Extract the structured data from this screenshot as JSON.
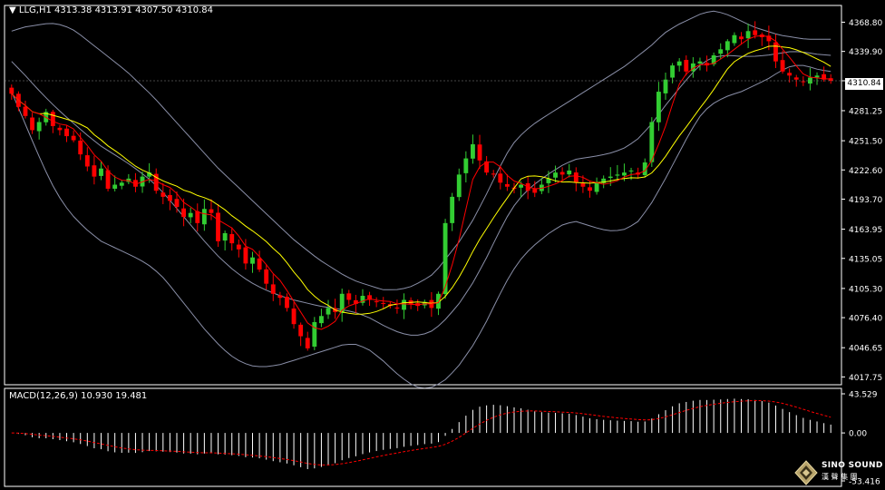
{
  "header": {
    "symbol": "LLG,H1",
    "ohlc": "4313.38 4313.91 4307.50 4310.84"
  },
  "price_tag": "4310.84",
  "macd_header": "MACD(12,26,9) 10.930 19.481",
  "logo": {
    "en": "SINO SOUND",
    "cn": "漢 聲 集 團"
  },
  "colors": {
    "background": "#000000",
    "bull_candle": "#32CD32",
    "bear_candle": "#FF0000",
    "ma_fast": "#FF0000",
    "ma_slow": "#FFFF00",
    "bands": "#8A8FA8",
    "macd_hist": "#FFFFFF",
    "macd_signal": "#FF0000",
    "axis": "#FFFFFF"
  },
  "chart_data": [
    {
      "type": "candlestick",
      "symbol": "LLG",
      "timeframe": "H1",
      "y_ticks": [
        "4368.80",
        "4339.90",
        "4310.84",
        "4281.25",
        "4251.50",
        "4222.60",
        "4193.70",
        "4163.95",
        "4135.05",
        "4105.30",
        "4076.40",
        "4046.65",
        "4017.75"
      ],
      "ylim": [
        4010,
        4380
      ],
      "grid": false,
      "close": [
        4298,
        4285,
        4276,
        4262,
        4270,
        4280,
        4266,
        4262,
        4256,
        4252,
        4238,
        4226,
        4216,
        4224,
        4204,
        4208,
        4210,
        4214,
        4206,
        4216,
        4220,
        4202,
        4196,
        4192,
        4186,
        4176,
        4180,
        4170,
        4184,
        4180,
        4152,
        4160,
        4150,
        4144,
        4130,
        4136,
        4124,
        4110,
        4100,
        4096,
        4086,
        4070,
        4058,
        4046,
        4072,
        4078,
        4086,
        4082,
        4100,
        4094,
        4090,
        4098,
        4094,
        4092,
        4090,
        4088,
        4086,
        4094,
        4090,
        4088,
        4092,
        4086,
        4100,
        4170,
        4196,
        4218,
        4234,
        4248,
        4232,
        4220,
        4218,
        4210,
        4206,
        4204,
        4208,
        4202,
        4200,
        4208,
        4214,
        4220,
        4218,
        4222,
        4210,
        4206,
        4202,
        4210,
        4214,
        4216,
        4218,
        4220,
        4222,
        4218,
        4230,
        4270,
        4300,
        4312,
        4326,
        4330,
        4320,
        4328,
        4330,
        4326,
        4336,
        4342,
        4350,
        4356,
        4352,
        4360,
        4356,
        4354,
        4350,
        4330,
        4320,
        4316,
        4312,
        4310,
        4314,
        4316,
        4312,
        4310.84
      ],
      "bollinger": {
        "upper": [
          4360,
          4364,
          4366,
          4368,
          4366,
          4360,
          4350,
          4340,
          4330,
          4320,
          4308,
          4296,
          4282,
          4268,
          4254,
          4240,
          4226,
          4214,
          4202,
          4190,
          4178,
          4166,
          4154,
          4144,
          4134,
          4126,
          4118,
          4112,
          4108,
          4104,
          4104,
          4106,
          4112,
          4120,
          4136,
          4152,
          4172,
          4196,
          4222,
          4246,
          4260,
          4270,
          4278,
          4286,
          4294,
          4302,
          4310,
          4318,
          4326,
          4336,
          4346,
          4358,
          4366,
          4372,
          4378,
          4380,
          4376,
          4370,
          4364,
          4360,
          4356,
          4354,
          4352,
          4352,
          4352
        ],
        "lower": [
          4300,
          4270,
          4240,
          4212,
          4190,
          4174,
          4162,
          4152,
          4146,
          4140,
          4134,
          4126,
          4114,
          4098,
          4082,
          4066,
          4052,
          4040,
          4032,
          4028,
          4028,
          4030,
          4034,
          4038,
          4042,
          4046,
          4050,
          4050,
          4044,
          4034,
          4022,
          4012,
          4006,
          4008,
          4016,
          4030,
          4048,
          4070,
          4096,
          4120,
          4138,
          4150,
          4160,
          4168,
          4172,
          4168,
          4164,
          4162,
          4164,
          4172,
          4190,
          4212,
          4236,
          4260,
          4280,
          4290,
          4296,
          4300,
          4306,
          4312,
          4320,
          4326,
          4326,
          4322,
          4320
        ]
      },
      "macd": {
        "ylim": [
          -53.416,
          43.529
        ],
        "y_ticks": [
          "43.529",
          "0.00",
          "-53.416"
        ],
        "fast": 12,
        "slow": 26,
        "signal": 9,
        "main_last": 10.93,
        "signal_last": 19.481
      }
    }
  ]
}
